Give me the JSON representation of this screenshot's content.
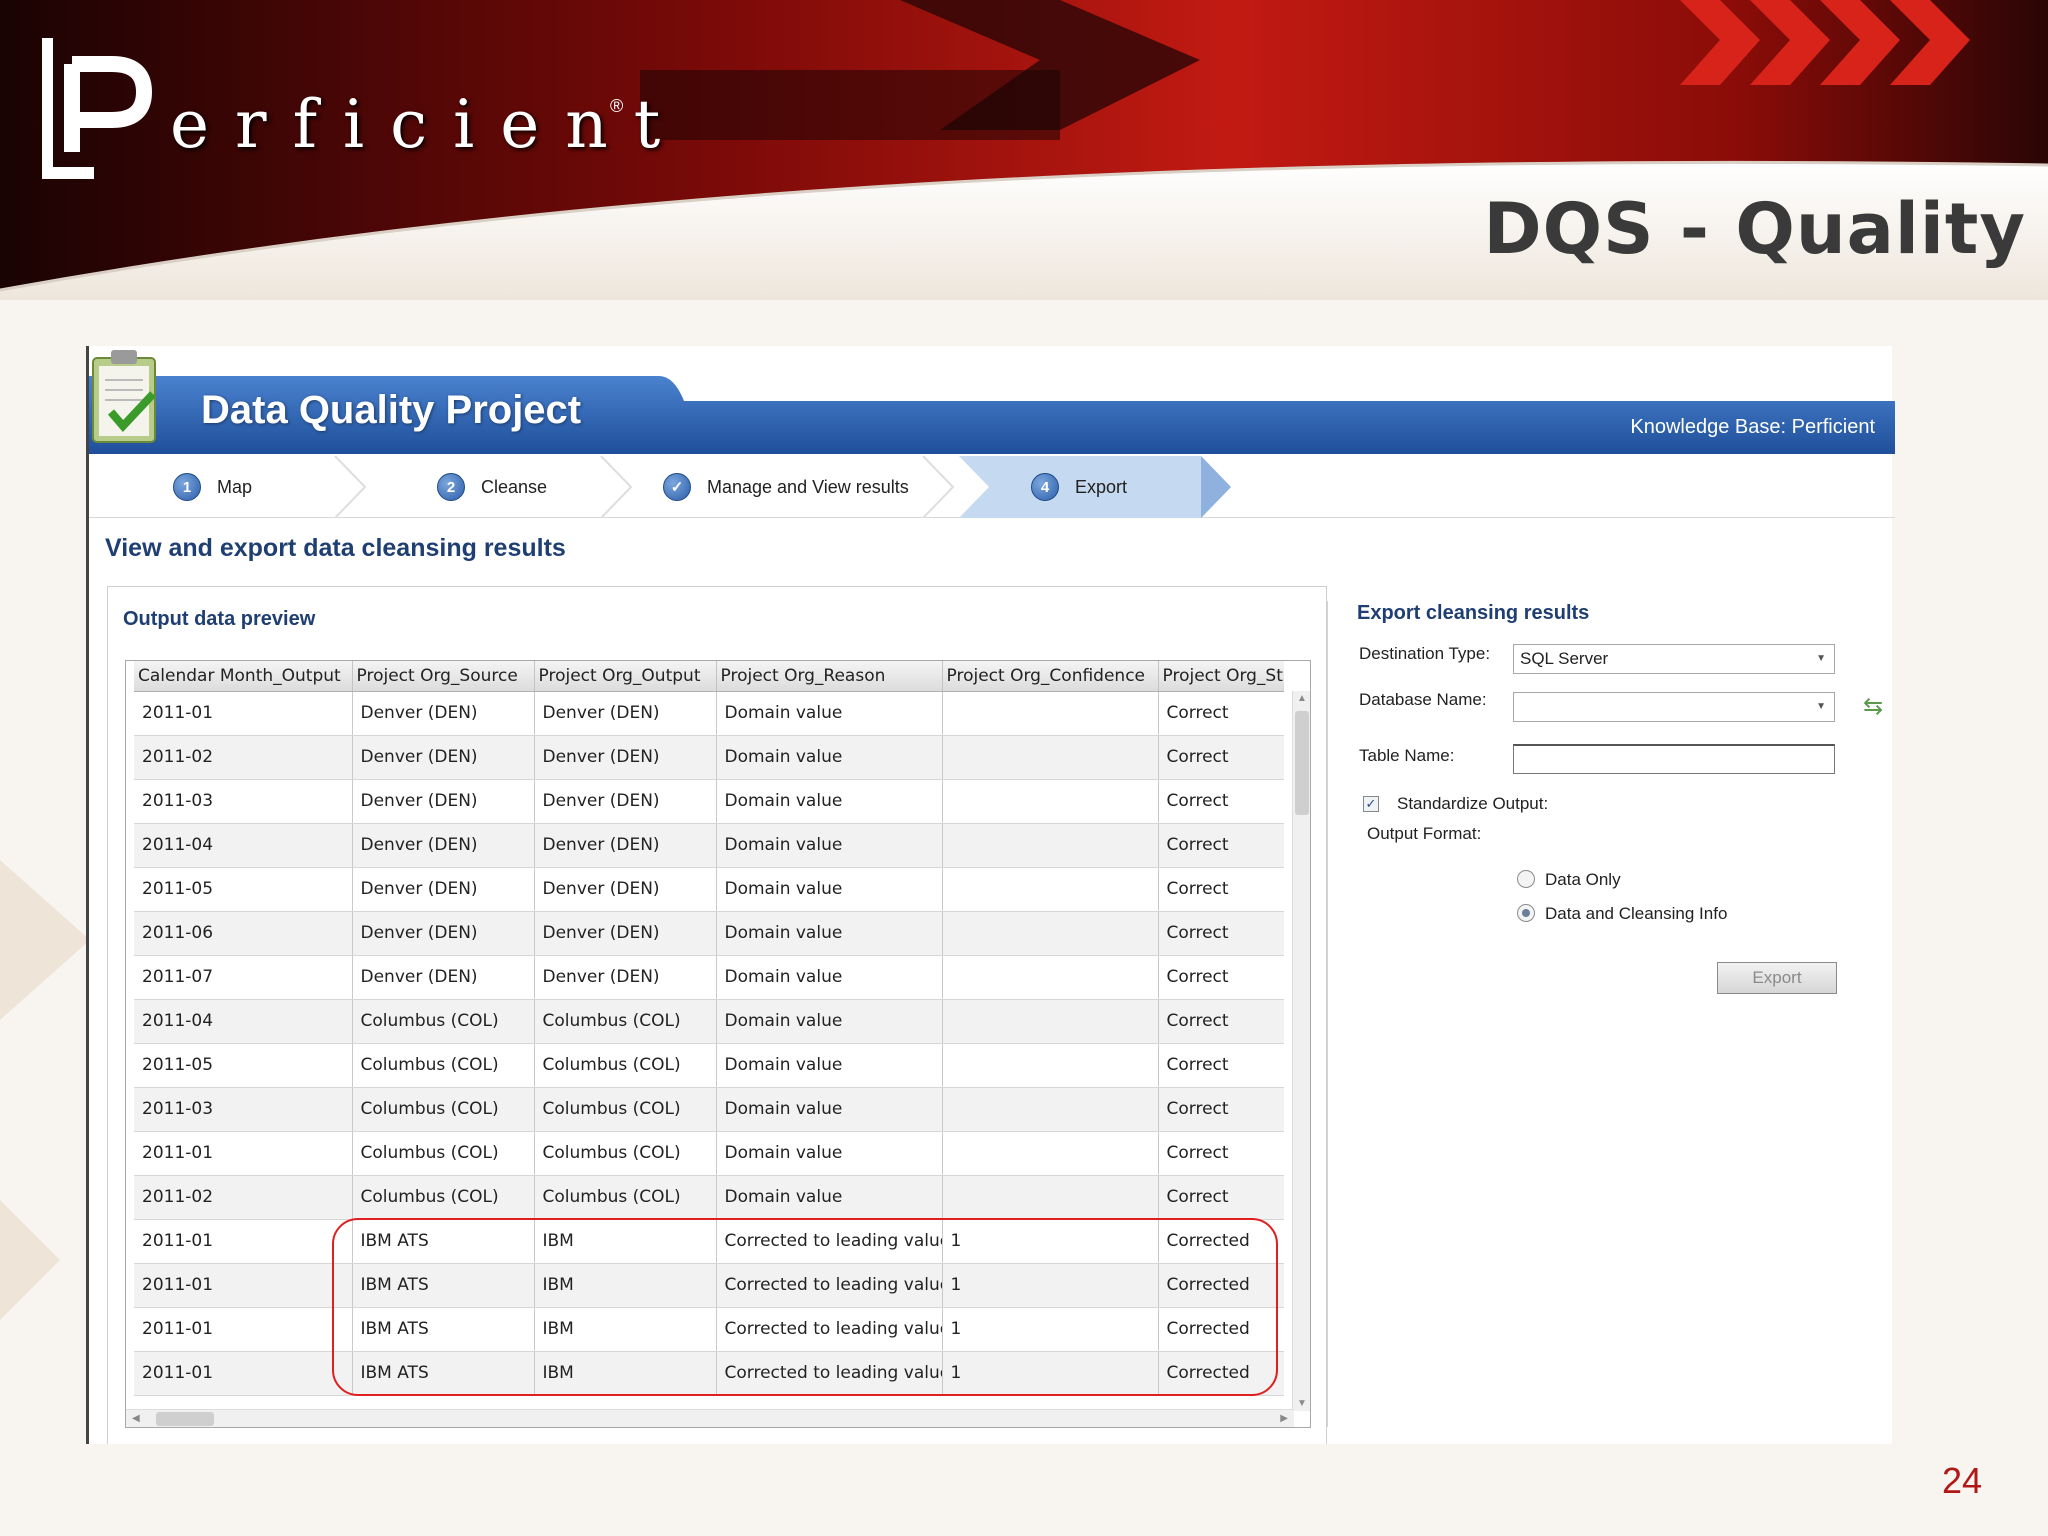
{
  "slide": {
    "logo_text": "erficient",
    "logo_initial": "P",
    "logo_tm": "®",
    "title": "DQS - Quality",
    "page_number": "24"
  },
  "app": {
    "title": "Data Quality Project",
    "knowledge_base": "Knowledge Base: Perficient",
    "steps": [
      {
        "num": "1",
        "label": "Map"
      },
      {
        "num": "2",
        "label": "Cleanse"
      },
      {
        "num": "✓",
        "label": "Manage and View results"
      },
      {
        "num": "4",
        "label": "Export"
      }
    ],
    "page_title": "View and export data cleansing results"
  },
  "preview": {
    "title": "Output data preview",
    "columns": [
      "Calendar Month_Output",
      "Project Org_Source",
      "Project Org_Output",
      "Project Org_Reason",
      "Project Org_Confidence",
      "Project Org_Sta"
    ],
    "rows": [
      [
        "2011-01",
        "Denver (DEN)",
        "Denver (DEN)",
        "Domain value",
        "",
        "Correct"
      ],
      [
        "2011-02",
        "Denver (DEN)",
        "Denver (DEN)",
        "Domain value",
        "",
        "Correct"
      ],
      [
        "2011-03",
        "Denver (DEN)",
        "Denver (DEN)",
        "Domain value",
        "",
        "Correct"
      ],
      [
        "2011-04",
        "Denver (DEN)",
        "Denver (DEN)",
        "Domain value",
        "",
        "Correct"
      ],
      [
        "2011-05",
        "Denver (DEN)",
        "Denver (DEN)",
        "Domain value",
        "",
        "Correct"
      ],
      [
        "2011-06",
        "Denver (DEN)",
        "Denver (DEN)",
        "Domain value",
        "",
        "Correct"
      ],
      [
        "2011-07",
        "Denver (DEN)",
        "Denver (DEN)",
        "Domain value",
        "",
        "Correct"
      ],
      [
        "2011-04",
        "Columbus (COL)",
        "Columbus (COL)",
        "Domain value",
        "",
        "Correct"
      ],
      [
        "2011-05",
        "Columbus (COL)",
        "Columbus (COL)",
        "Domain value",
        "",
        "Correct"
      ],
      [
        "2011-03",
        "Columbus (COL)",
        "Columbus (COL)",
        "Domain value",
        "",
        "Correct"
      ],
      [
        "2011-01",
        "Columbus (COL)",
        "Columbus (COL)",
        "Domain value",
        "",
        "Correct"
      ],
      [
        "2011-02",
        "Columbus (COL)",
        "Columbus (COL)",
        "Domain value",
        "",
        "Correct"
      ],
      [
        "2011-01",
        "IBM ATS",
        "IBM",
        "Corrected to leading value",
        "1",
        "Corrected"
      ],
      [
        "2011-01",
        "IBM ATS",
        "IBM",
        "Corrected to leading value",
        "1",
        "Corrected"
      ],
      [
        "2011-01",
        "IBM ATS",
        "IBM",
        "Corrected to leading value",
        "1",
        "Corrected"
      ],
      [
        "2011-01",
        "IBM ATS",
        "IBM",
        "Corrected to leading value",
        "1",
        "Corrected"
      ]
    ]
  },
  "export": {
    "title": "Export cleansing results",
    "destination_label": "Destination Type:",
    "destination_value": "SQL Server",
    "database_label": "Database Name:",
    "database_value": "",
    "table_label": "Table Name:",
    "table_value": "",
    "standardize_label": "Standardize Output:",
    "standardize_checked": true,
    "format_label": "Output Format:",
    "format_options": [
      "Data Only",
      "Data and Cleansing Info"
    ],
    "format_selected": "Data and Cleansing Info",
    "export_button": "Export"
  },
  "colors": {
    "header_red": "#b01818",
    "app_blue": "#2f62b0",
    "title_navy": "#1f3f73",
    "highlight": "#e02020"
  }
}
